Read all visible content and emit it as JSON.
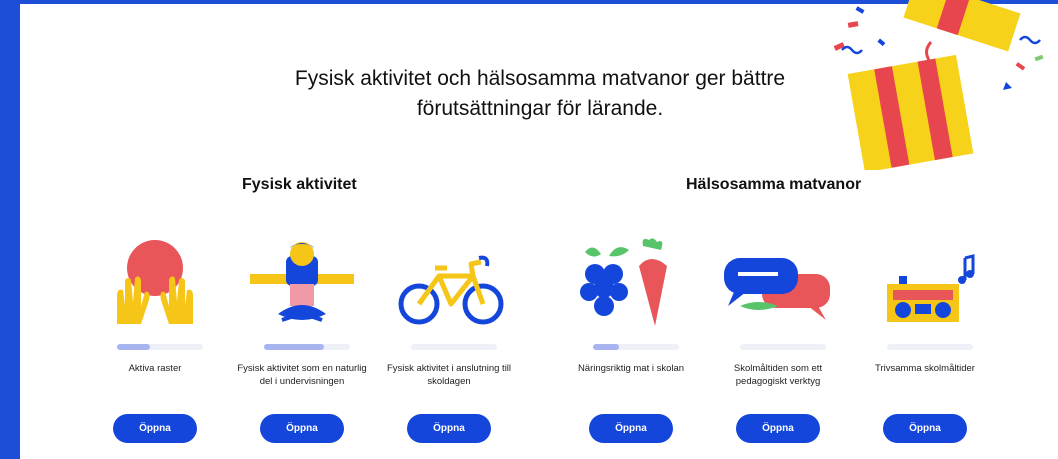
{
  "headline": {
    "line1": "Fysisk aktivitet och hälsosamma matvanor ger bättre",
    "line2": "förutsättningar för lärande."
  },
  "sections": [
    {
      "title": "Fysisk aktivitet",
      "cards": [
        {
          "label": "Aktiva raster",
          "icon": "hands-ball-icon",
          "progress": 0.38,
          "button": "Öppna"
        },
        {
          "label": "Fysisk aktivitet som en naturlig del i undervisningen",
          "icon": "person-meditating-icon",
          "progress": 0.7,
          "button": "Öppna"
        },
        {
          "label": "Fysisk aktivitet i anslutning till skoldagen",
          "icon": "bicycle-icon",
          "progress": 0.0,
          "button": "Öppna"
        }
      ]
    },
    {
      "title": "Hälsosamma matvanor",
      "cards": [
        {
          "label": "Näringsriktig mat i skolan",
          "icon": "grapes-carrot-icon",
          "progress": 0.3,
          "button": "Öppna"
        },
        {
          "label": "Skolmåltiden som ett pedagogiskt verktyg",
          "icon": "speech-bubbles-icon",
          "progress": 0.0,
          "button": "Öppna"
        },
        {
          "label": "Trivsamma skolmåltider",
          "icon": "radio-music-icon",
          "progress": 0.0,
          "button": "Öppna"
        }
      ]
    }
  ],
  "colors": {
    "brand_blue": "#1446dc",
    "progress_track": "#eef0f8",
    "progress_fill": "#a8b4f0",
    "gift_yellow": "#f7d21a",
    "gift_red": "#e8464e"
  }
}
